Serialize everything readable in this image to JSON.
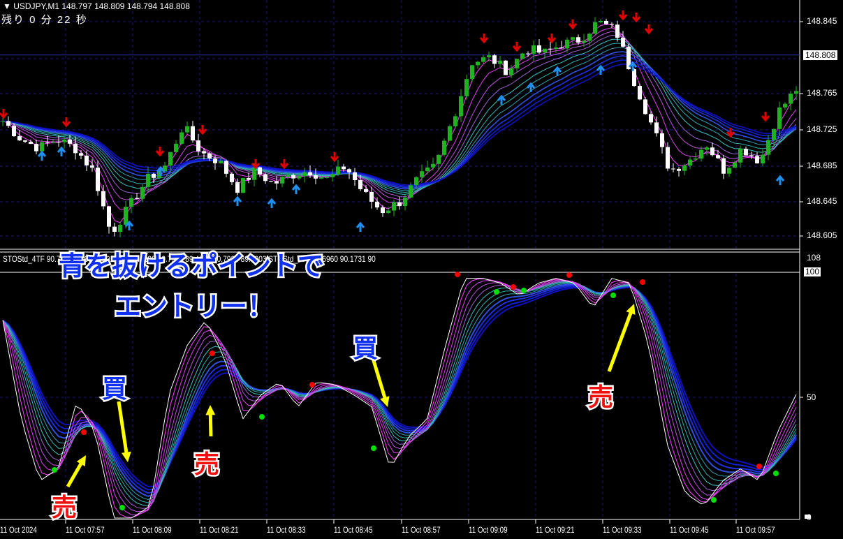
{
  "header": {
    "symbol_line": "USDJPY,M1  148.797 148.809 148.794 148.808",
    "countdown": "残り 0 分 22 秒"
  },
  "price_axis": {
    "labels": [
      "148.845",
      "148.765",
      "148.725",
      "148.685",
      "148.645",
      "148.605"
    ],
    "current_price": "148.808"
  },
  "indicator": {
    "label": "STOStd_4TF 90.7926 88.6327 90.7926 89.0696 90.7926 89.4572 90.7926 89.8003  STOStd_4TF 90.6960 90.1731 90",
    "label_prefix": "STOStd_4TF 9",
    "axis": {
      "top": "108",
      "max": "100",
      "mid": "50",
      "min": "0"
    }
  },
  "time_axis": [
    "11 Oct 2024",
    "11 Oct 07:57",
    "11 Oct 08:09",
    "11 Oct 08:21",
    "11 Oct 08:33",
    "11 Oct 08:45",
    "11 Oct 08:57",
    "11 Oct 09:09",
    "11 Oct 09:21",
    "11 Oct 09:33",
    "11 Oct 09:45",
    "11 Oct 09:57"
  ],
  "annotations": {
    "headline1": "青を抜けるポイントで",
    "headline2": "エントリー！",
    "buy": "買",
    "sell": "売"
  },
  "colors": {
    "bull": "#1fb31f",
    "bear": "#ffffff",
    "grid": "#1a1a7a",
    "arrow": "#ffff00",
    "sell_dot": "#ff0000",
    "buy_dot": "#00e000"
  },
  "chart_data": {
    "type": "candlestick",
    "symbol": "USDJPY",
    "timeframe": "M1",
    "ylim": [
      148.595,
      148.855
    ],
    "approx_close_path": [
      148.735,
      148.715,
      148.705,
      148.715,
      148.705,
      148.68,
      148.61,
      148.64,
      148.67,
      148.685,
      148.73,
      148.7,
      148.69,
      148.66,
      148.68,
      148.665,
      148.675,
      148.68,
      148.67,
      148.685,
      148.655,
      148.635,
      148.645,
      148.67,
      148.685,
      148.74,
      148.8,
      148.805,
      148.79,
      148.815,
      148.81,
      148.82,
      148.825,
      148.845,
      148.835,
      148.78,
      148.73,
      148.68,
      148.69,
      148.71,
      148.68,
      148.705,
      148.69,
      148.745,
      148.77
    ],
    "oscillator_path": [
      80,
      40,
      15,
      20,
      47,
      35,
      0,
      0,
      5,
      50,
      70,
      80,
      65,
      40,
      50,
      55,
      45,
      55,
      54,
      50,
      45,
      20,
      33,
      40,
      70,
      97,
      97,
      95,
      90,
      95,
      97,
      95,
      85,
      97,
      95,
      70,
      30,
      10,
      5,
      15,
      20,
      15,
      35,
      50
    ]
  }
}
